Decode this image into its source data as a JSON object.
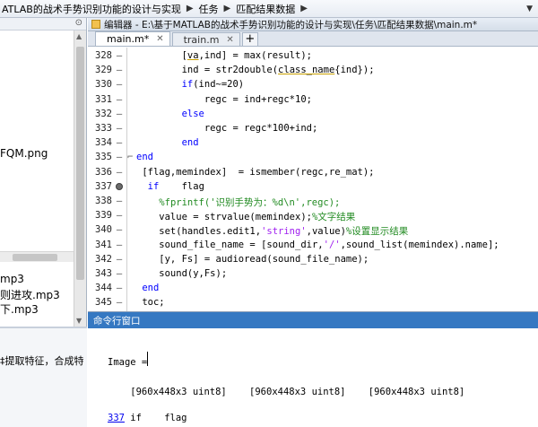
{
  "breadcrumb": {
    "items": [
      "ATLAB的战术手势识别功能的设计与实现",
      "任务",
      "匹配结果数据"
    ],
    "dropdown_icon": "chevron-down-icon"
  },
  "left_panel": {
    "hide_icon": "hide-panel-icon",
    "files_top": [
      "FQM.png"
    ],
    "files_bottom": [
      "mp3",
      "则进攻.mp3",
      "下.mp3"
    ],
    "detail_text": "‡提取特征，合成特"
  },
  "editor": {
    "title": "编辑器 - E:\\基于MATLAB的战术手势识别功能的设计与实现\\任务\\匹配结果数据\\main.m*",
    "tabs": [
      {
        "label": "main.m*",
        "active": true
      },
      {
        "label": "train.m",
        "active": false
      }
    ],
    "add_tab_label": "+",
    "lines": [
      {
        "n": "328",
        "html": "        [<span class=\"ul\">va</span>,ind] = max(result);"
      },
      {
        "n": "329",
        "html": "        ind = str2double(<span class=\"ul\">class_name</span>{ind});"
      },
      {
        "n": "330",
        "html": "        <span class=\"kw\">if</span>(ind~=20)"
      },
      {
        "n": "331",
        "html": "            regc = ind+regc*10;"
      },
      {
        "n": "332",
        "html": "        <span class=\"kw\">else</span>"
      },
      {
        "n": "333",
        "html": "            regc = regc*100+ind;"
      },
      {
        "n": "334",
        "html": "        <span class=\"kw\">end</span>"
      },
      {
        "n": "335",
        "html": "<span class=\"kw\">end</span>",
        "fold": "⌐"
      },
      {
        "n": "336",
        "html": " [flag,memindex]  = ismember(regc,re_mat);"
      },
      {
        "n": "337",
        "html": "  <span class=\"kw\">if</span>    flag",
        "breakpoint": true
      },
      {
        "n": "338",
        "html": "    <span class=\"cm\">%fprintf('识别手势为：%d\\n',regc);</span>"
      },
      {
        "n": "339",
        "html": "    value = strvalue(memindex);<span class=\"cm\">%文字结果</span>"
      },
      {
        "n": "340",
        "html": "    set(handles.edit1,<span class=\"str\">'string'</span>,value)<span class=\"cm\">%设置显示结果</span>"
      },
      {
        "n": "341",
        "html": "    sound_file_name = [sound_dir,<span class=\"str\">'/'</span>,sound_list(memindex).name];"
      },
      {
        "n": "342",
        "html": "    [y, Fs] = audioread(sound_file_name);"
      },
      {
        "n": "343",
        "html": "    sound(y,Fs);"
      },
      {
        "n": "344",
        "html": " <span class=\"kw\">end</span>"
      },
      {
        "n": "345",
        "html": " toc;"
      }
    ]
  },
  "command_window": {
    "title": "命令行窗口",
    "output_label": "Image =",
    "dims_line": "    [960x448x3 uint8]    [960x448x3 uint8]    [960x448x3 uint8]",
    "link_text": "337",
    "link_rest": " if    flag"
  }
}
